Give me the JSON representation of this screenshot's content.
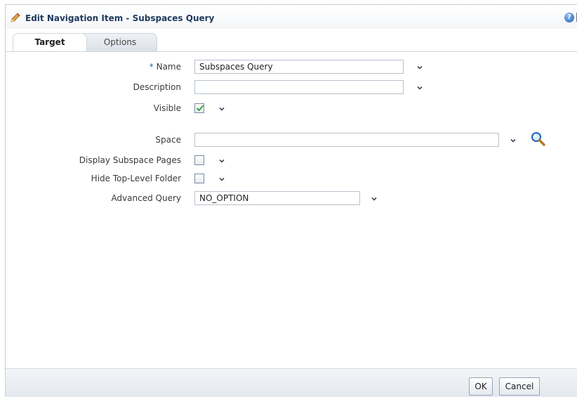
{
  "dialog": {
    "title": "Edit Navigation Item - Subspaces Query",
    "help_glyph": "?",
    "close_glyph": "✕"
  },
  "tabs": [
    {
      "label": "Target",
      "active": true
    },
    {
      "label": "Options",
      "active": false
    }
  ],
  "form": {
    "name": {
      "required_mark": "*",
      "label": "Name",
      "value": "Subspaces Query"
    },
    "description": {
      "label": "Description",
      "value": ""
    },
    "visible": {
      "label": "Visible",
      "checked": true
    },
    "space": {
      "label": "Space",
      "value": ""
    },
    "display_subspace_pages": {
      "label": "Display Subspace Pages",
      "checked": false
    },
    "hide_top_level_folder": {
      "label": "Hide Top-Level Folder",
      "checked": false
    },
    "advanced_query": {
      "label": "Advanced Query",
      "value": "NO_OPTION"
    }
  },
  "footer": {
    "ok_label": "OK",
    "cancel_label": "Cancel"
  },
  "icons": {
    "title": "pencil-icon",
    "help": "help-icon",
    "close": "close-icon",
    "dropdown": "chevron-down-icon",
    "search": "magnifier-icon",
    "check": "checkmark-icon"
  },
  "colors": {
    "title_text": "#1f3a5c",
    "accent": "#1f62b8",
    "check": "#3aa13a"
  }
}
